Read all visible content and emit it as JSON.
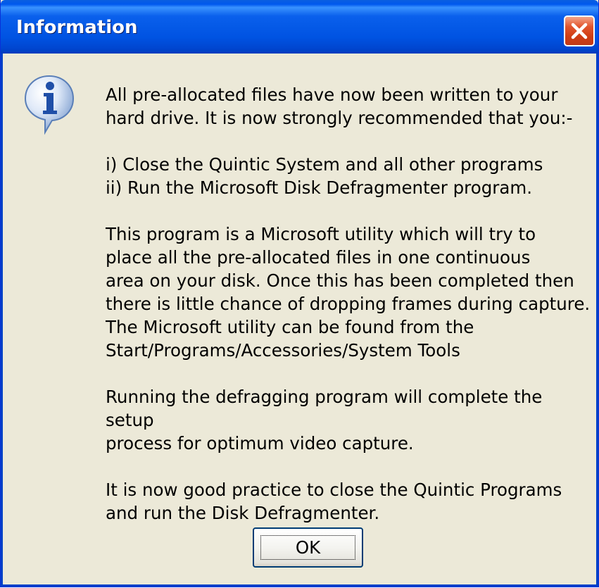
{
  "window": {
    "title": "Information",
    "close_icon": "close-icon"
  },
  "dialog": {
    "icon": "information-icon",
    "paragraphs": [
      "All pre-allocated files have now been written to your\nhard drive. It is now strongly recommended that you:-",
      "i) Close the Quintic System and all other programs\nii) Run the Microsoft Disk Defragmenter program.",
      "This program is a Microsoft utility which will try to\nplace all the pre-allocated files in one continuous\narea on your disk. Once this has been completed then\nthere is little chance of dropping frames during capture.\nThe Microsoft utility can be found from the\nStart/Programs/Accessories/System Tools",
      "Running the defragging program will complete the setup\nprocess for optimum video capture.",
      "It is now good practice to close the Quintic Programs\nand run the Disk Defragmenter."
    ],
    "ok_label": "OK"
  },
  "colors": {
    "titlebar": "#0058ee",
    "body_background": "#ece9d8",
    "close_button": "#e2552e"
  }
}
